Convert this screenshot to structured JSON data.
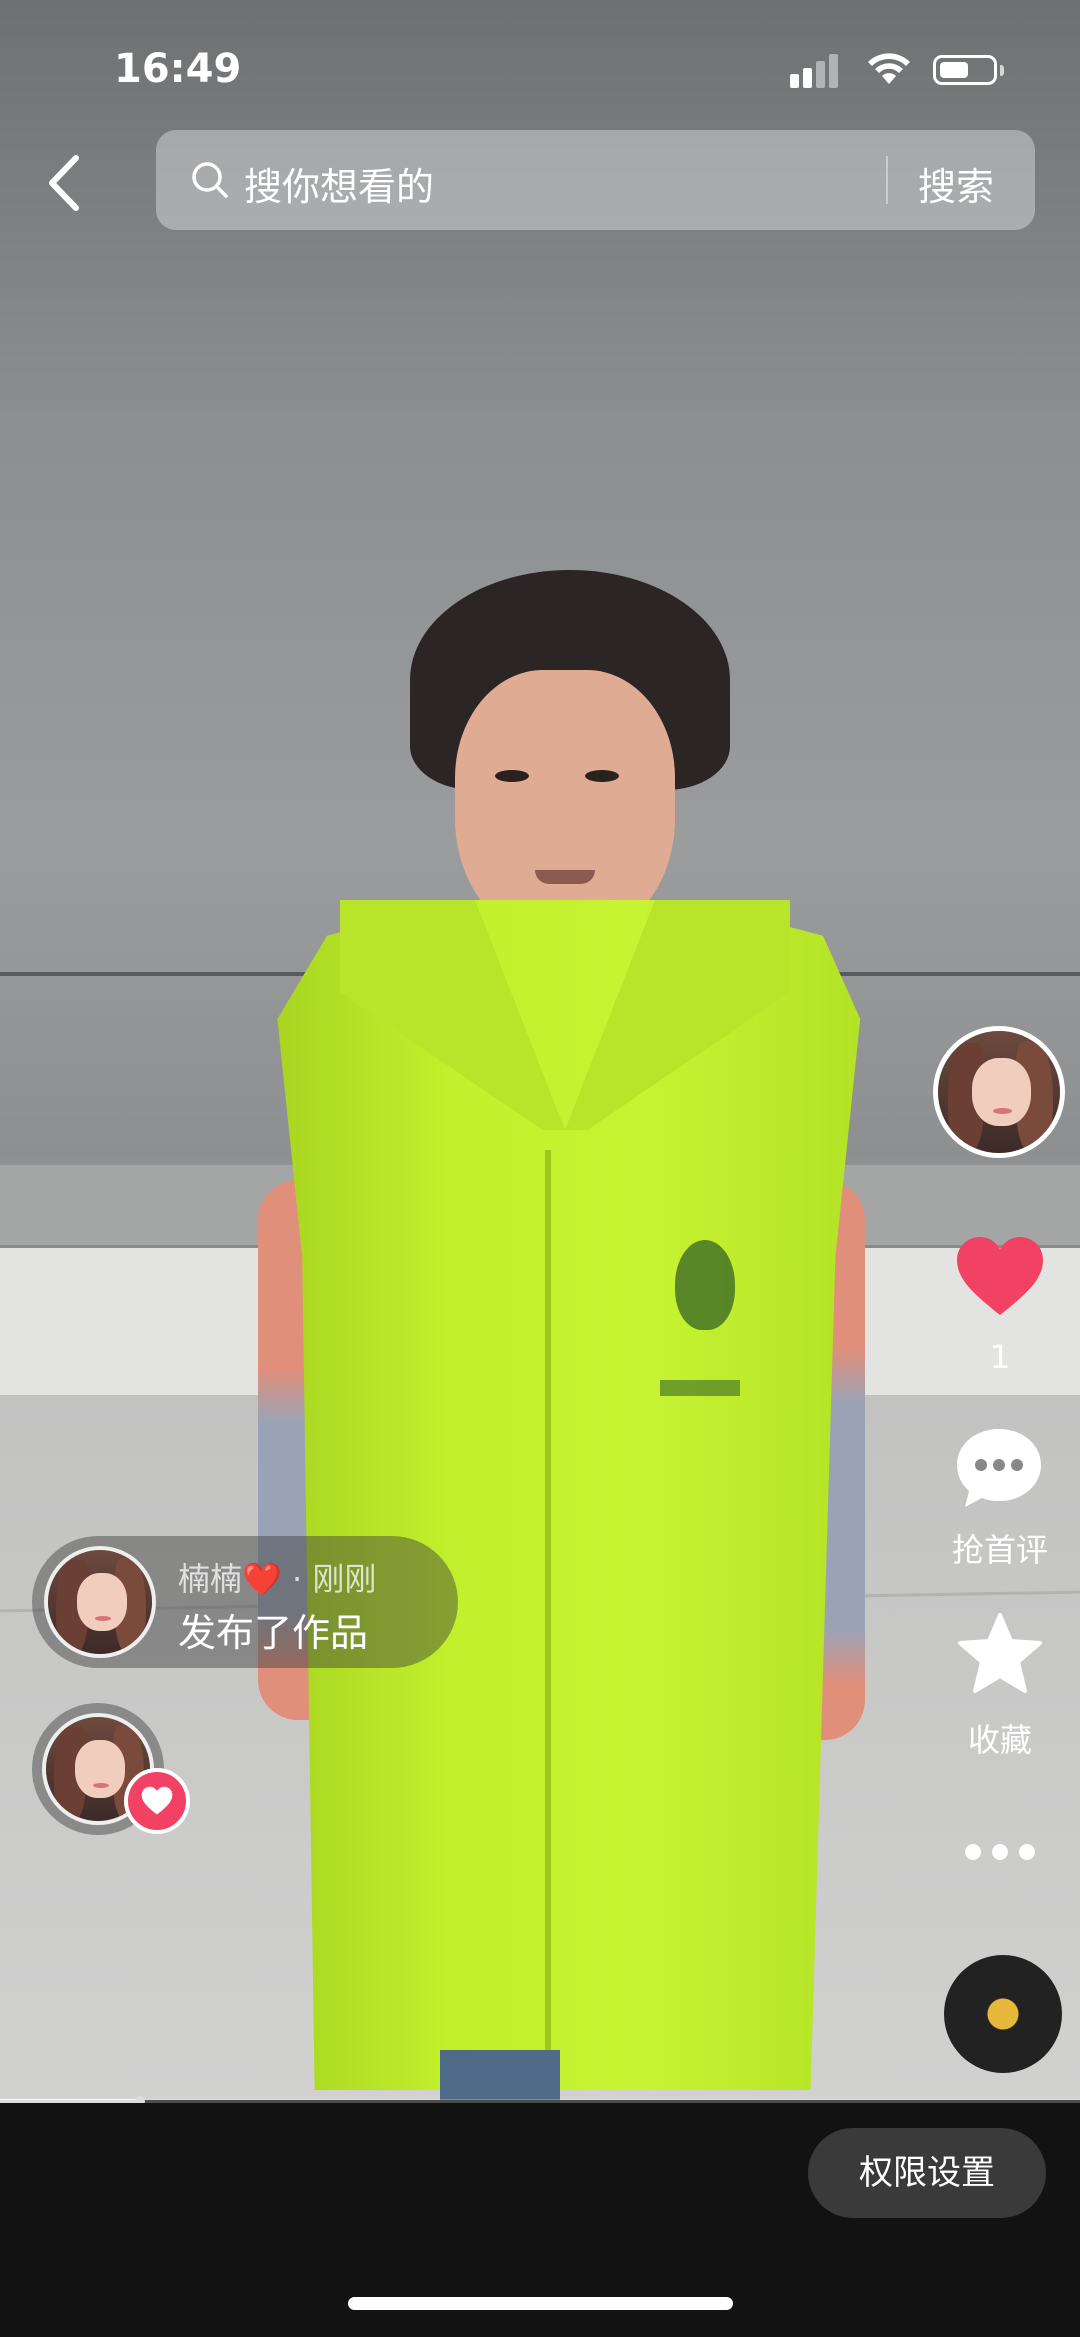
{
  "status_bar": {
    "time": "16:49"
  },
  "search": {
    "placeholder": "搜你想看的",
    "button_label": "搜索"
  },
  "actions": {
    "like_count": "1",
    "comment_label": "抢首评",
    "favorite_label": "收藏"
  },
  "notification": {
    "user_name": "楠楠",
    "heart": "❤️",
    "separator": "·",
    "time": "刚刚",
    "action_text": "发布了作品"
  },
  "bottom": {
    "permission_button": "权限设置"
  },
  "playback": {
    "progress": 0.13
  },
  "colors": {
    "like": "#f24263",
    "accent_badge": "#f24263",
    "disc_center": "#e7b93a"
  },
  "icons": [
    "back-icon",
    "search-icon",
    "heart-icon",
    "comment-icon",
    "star-icon",
    "more-icon",
    "music-disc-icon",
    "signal-icon",
    "wifi-icon",
    "battery-icon"
  ]
}
